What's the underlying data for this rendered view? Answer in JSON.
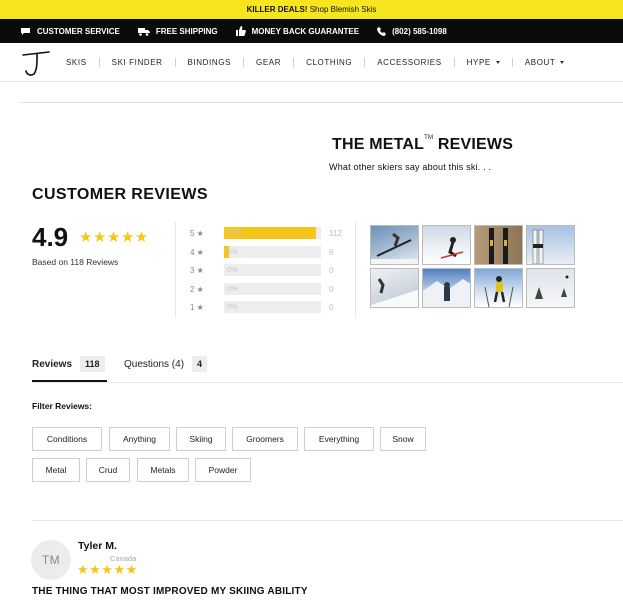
{
  "promo": {
    "bold": "KILLER DEALS!",
    "link": "Shop Blemish Skis"
  },
  "infobar": {
    "items": [
      {
        "label": "CUSTOMER SERVICE",
        "icon": "chat-icon"
      },
      {
        "label": "FREE SHIPPING",
        "icon": "truck-icon"
      },
      {
        "label": "MONEY BACK GUARANTEE",
        "icon": "thumbs-up-icon"
      },
      {
        "label": "(802) 585-1098",
        "icon": "phone-icon"
      }
    ]
  },
  "nav": {
    "items": [
      {
        "label": "SKIS",
        "dropdown": false
      },
      {
        "label": "SKI FINDER",
        "dropdown": false
      },
      {
        "label": "BINDINGS",
        "dropdown": false
      },
      {
        "label": "GEAR",
        "dropdown": false
      },
      {
        "label": "CLOTHING",
        "dropdown": false
      },
      {
        "label": "ACCESSORIES",
        "dropdown": false
      },
      {
        "label": "HYPE",
        "dropdown": true
      },
      {
        "label": "ABOUT",
        "dropdown": true
      }
    ]
  },
  "hero": {
    "title": "THE METAL",
    "tm": "TM",
    "title_suffix": " REVIEWS",
    "subtitle": "What other skiers say about this ski. . ."
  },
  "reviews": {
    "heading": "CUSTOMER REVIEWS",
    "average": "4.9",
    "stars": "★★★★★",
    "based_on": "Based on 118 Reviews",
    "histogram": [
      {
        "label": "5 ★",
        "percent": 95,
        "percent_label": "95%",
        "count": "112"
      },
      {
        "label": "4 ★",
        "percent": 5,
        "percent_label": "5%",
        "count": "6"
      },
      {
        "label": "3 ★",
        "percent": 0,
        "percent_label": "0%",
        "count": "0"
      },
      {
        "label": "2 ★",
        "percent": 0,
        "percent_label": "0%",
        "count": "0"
      },
      {
        "label": "1 ★",
        "percent": 0,
        "percent_label": "0%",
        "count": "0"
      }
    ]
  },
  "tabs": [
    {
      "label": "Reviews",
      "badge": "118",
      "active": true
    },
    {
      "label": "Questions (4)",
      "badge": "4",
      "active": false
    }
  ],
  "filters": {
    "label": "Filter Reviews:",
    "chips": [
      "Conditions",
      "Anything",
      "Skiing",
      "Groomers",
      "Everything",
      "Snow",
      "Metal",
      "Crud",
      "Metals",
      "Powder"
    ]
  },
  "review": {
    "initials": "TM",
    "name": "Tyler M.",
    "location": "Canada",
    "stars": "★★★★★",
    "title": "THE THING THAT MOST IMPROVED MY SKIING ABILITY"
  },
  "colors": {
    "promo_bg": "#f7e51e",
    "infobar_bg": "#0b0b0b",
    "star": "#f5c518"
  }
}
